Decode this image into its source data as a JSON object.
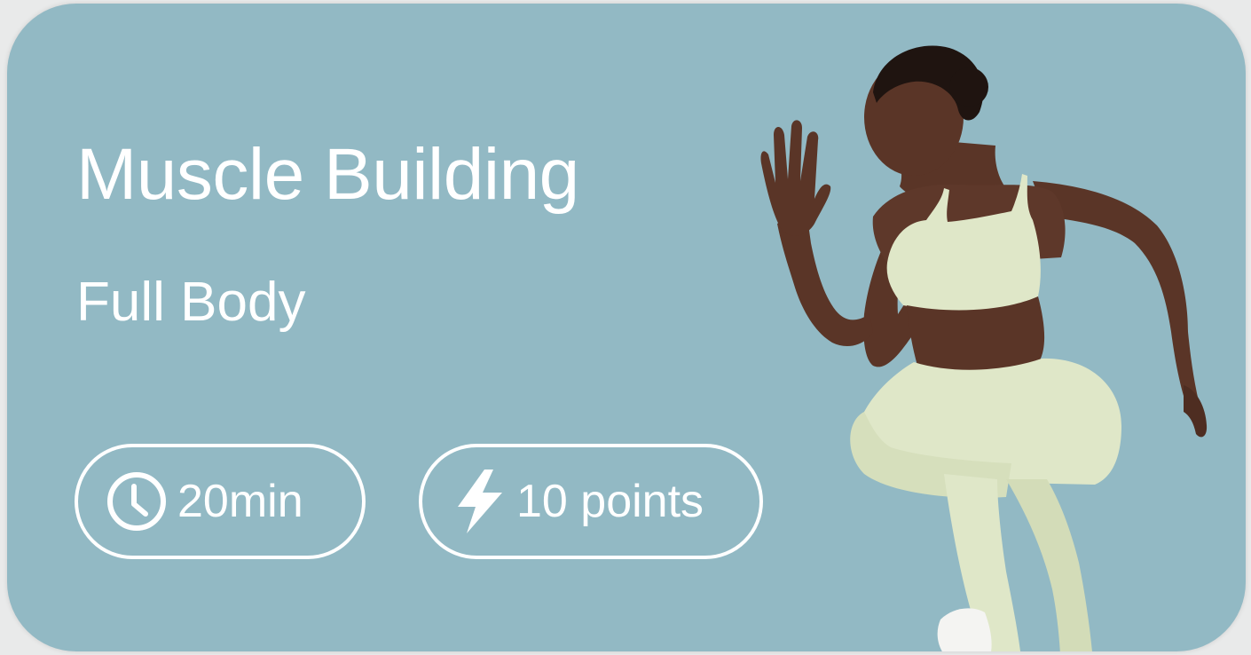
{
  "card": {
    "title": "Muscle Building",
    "subtitle": "Full Body",
    "duration": "20min",
    "points": "10 points",
    "background_color": "#92b9c4",
    "text_color": "#ffffff"
  },
  "icons": {
    "duration": "clock-icon",
    "points": "lightning-bolt-icon"
  },
  "image": {
    "subject": "athlete-photo"
  }
}
